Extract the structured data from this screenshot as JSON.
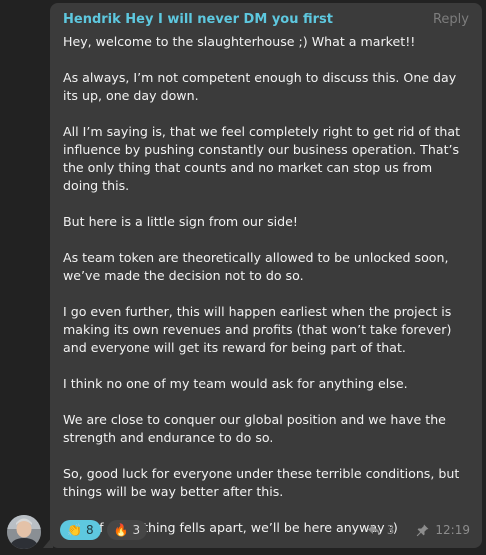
{
  "message": {
    "sender": "Hendrik Hey I will never DM you first",
    "reply_label": "Reply",
    "paragraphs": [
      "Hey, welcome to the slaughterhouse ;) What a market!!",
      "As always, I’m not competent enough to discuss this. One day its up, one day down.",
      "All I’m saying is, that we feel completely right to get rid of that influence by pushing constantly our business operation. That’s the only thing that counts and no market can stop us from doing this.",
      "But here is a little sign from our side!",
      "As team token are theoretically allowed to be unlocked soon, we’ve made the decision not to do so.",
      "I go even further, this will happen earliest when the project is making its own revenues and profits (that won’t take forever) and everyone will get its reward for being part of that.",
      "I think no one of my team would ask for anything else.",
      "We are close to conquer our global position and we have the strength and endurance to do so.",
      "So, good luck for everyone under these terrible conditions, but things will be way better after this.",
      "And, if everything fells apart, we’ll be here anyway :)"
    ],
    "reactions": [
      {
        "emoji": "👏",
        "count": "8",
        "icon": "clap-icon"
      },
      {
        "emoji": "🔥",
        "count": "3",
        "icon": "fire-icon"
      }
    ],
    "reply_count": "3",
    "time": "12:19",
    "colors": {
      "sender": "#5ec8df",
      "bubble": "#3b3b3b",
      "background": "#222222",
      "text": "#f2f2f2",
      "active_reaction": "#5ec8df"
    }
  }
}
